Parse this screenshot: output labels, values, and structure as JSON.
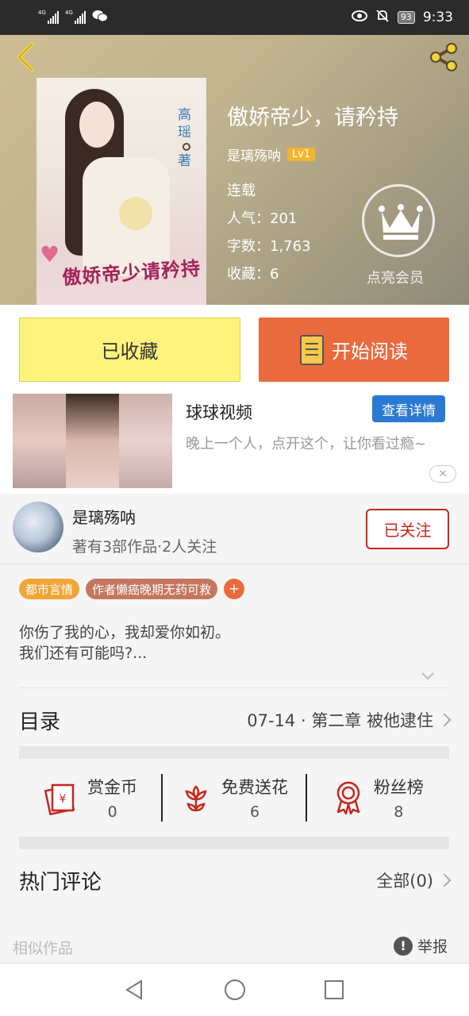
{
  "status_bar": {
    "net1": "4G",
    "net2": "4G",
    "battery": "93",
    "time": "9:33"
  },
  "book": {
    "title": "傲娇帝少，请矜持",
    "author": "是璃殇呐",
    "level": "Lv1",
    "status": "连载",
    "popularity": "人气：201",
    "word_count": "字数：1,763",
    "favorites": "收藏：6",
    "vip_label": "点亮会员",
    "cover_author": "高瑶",
    "cover_author_suffix": "著",
    "cover_title": "傲娇帝少请矜持"
  },
  "actions": {
    "fav_label": "已收藏",
    "read_label": "开始阅读"
  },
  "ad": {
    "title": "球球视频",
    "detail_label": "查看详情",
    "desc": "晚上一个人，点开这个，让你看过瘾~",
    "close_label": "✕"
  },
  "author_card": {
    "name": "是璃殇呐",
    "stats": "著有3部作品·2人关注",
    "follow_label": "已关注"
  },
  "tags": [
    "都市言情",
    "作者懒癌晚期无药可救"
  ],
  "tag_add": "+",
  "synopsis": {
    "line1": "你伤了我的心，我却爱你如初。",
    "line2": "我们还有可能吗?..."
  },
  "toc": {
    "title": "目录",
    "latest": "07-14 · 第二章 被他逮住"
  },
  "stats": [
    {
      "label": "赏金币",
      "value": "0",
      "icon": "red-envelope-icon"
    },
    {
      "label": "免费送花",
      "value": "6",
      "icon": "flower-icon"
    },
    {
      "label": "粉丝榜",
      "value": "8",
      "icon": "medal-icon"
    }
  ],
  "hot_comments": {
    "title": "热门评论",
    "all_label": "全部(0)"
  },
  "footer": {
    "similar": "相似作品",
    "report": "举报"
  },
  "colors": {
    "accent": "#ea6a3e",
    "fav": "#fdf37d",
    "follow": "#c7261f",
    "ad_button": "#2a7ad4"
  }
}
